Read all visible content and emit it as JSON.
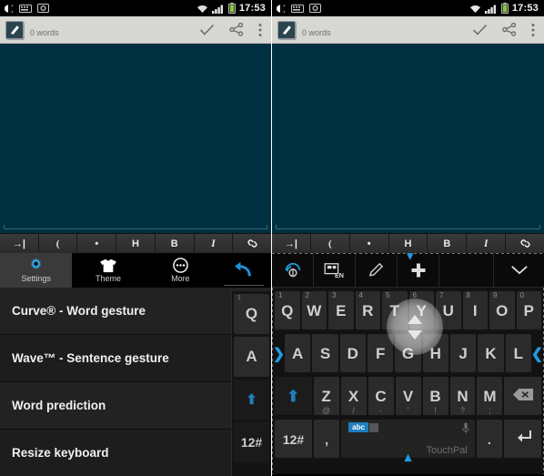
{
  "status_bar": {
    "time": "17:53",
    "left_icons": [
      "brightness-icon",
      "keyboard-icon",
      "screenshot-icon"
    ],
    "right_icons": [
      "wifi-icon",
      "signal-icon",
      "battery-icon"
    ],
    "battery_color": "#8ac63f"
  },
  "app_bar": {
    "logo": "notes-app-logo",
    "word_count": "0 words",
    "actions": [
      "done-check-icon",
      "share-icon",
      "overflow-menu-icon"
    ]
  },
  "editor": {
    "text": "",
    "background_color": "#013040"
  },
  "format_bar": {
    "keys": [
      {
        "label": "→|",
        "name": "tab-key"
      },
      {
        "label": "(",
        "name": "paren-key"
      },
      {
        "label": "•",
        "name": "bullet-key"
      },
      {
        "label": "H",
        "name": "heading-key"
      },
      {
        "label": "B",
        "name": "bold-key"
      },
      {
        "label": "I",
        "name": "italic-key"
      },
      {
        "label": "🔗",
        "name": "link-key"
      }
    ]
  },
  "left_panel": {
    "tabs": [
      {
        "label": "Settings",
        "icon": "gear-icon",
        "active": true
      },
      {
        "label": "Theme",
        "icon": "tshirt-icon",
        "active": false
      },
      {
        "label": "More",
        "icon": "more-dots-icon",
        "active": false
      }
    ],
    "back_icon": "back-arrow-icon",
    "settings_items": [
      {
        "label": "Curve® - Word gesture",
        "checked": true
      },
      {
        "label": "Wave™ - Sentence gesture",
        "checked": true
      },
      {
        "label": "Word prediction",
        "checked": true
      },
      {
        "label": "Resize keyboard",
        "checked": false
      }
    ],
    "peek_keys": [
      {
        "label": "Q",
        "hint": "1"
      },
      {
        "label": "A",
        "hint": ""
      },
      {
        "label": "⬆",
        "hint": ""
      },
      {
        "label": "12#",
        "hint": ""
      }
    ]
  },
  "right_panel": {
    "keyboard_toolbar": [
      {
        "name": "curve-gesture-icon"
      },
      {
        "name": "language-en-icon",
        "label": "EN"
      },
      {
        "name": "pencil-icon"
      },
      {
        "name": "plus-icon"
      },
      {
        "name": "chevron-down-icon"
      }
    ],
    "keyboard": {
      "row1": [
        {
          "key": "Q",
          "hint": "1"
        },
        {
          "key": "W",
          "hint": "2"
        },
        {
          "key": "E",
          "hint": "3"
        },
        {
          "key": "R",
          "hint": "4"
        },
        {
          "key": "T",
          "hint": "5"
        },
        {
          "key": "Y",
          "hint": "6"
        },
        {
          "key": "U",
          "hint": "7"
        },
        {
          "key": "I",
          "hint": "8"
        },
        {
          "key": "O",
          "hint": "9"
        },
        {
          "key": "P",
          "hint": "0"
        }
      ],
      "row2": [
        {
          "key": "A"
        },
        {
          "key": "S"
        },
        {
          "key": "D"
        },
        {
          "key": "F"
        },
        {
          "key": "G"
        },
        {
          "key": "H"
        },
        {
          "key": "J"
        },
        {
          "key": "K"
        },
        {
          "key": "L"
        }
      ],
      "row2_left_arrow": "❯",
      "row2_right_arrow": "❮",
      "row3_shift": "⬆",
      "row3": [
        {
          "key": "Z",
          "punct": "@"
        },
        {
          "key": "X",
          "punct": "/"
        },
        {
          "key": "C",
          "punct": "-"
        },
        {
          "key": "V",
          "punct": "'"
        },
        {
          "key": "B",
          "punct": "!"
        },
        {
          "key": "N",
          "punct": "?"
        },
        {
          "key": "M",
          "punct": ";"
        }
      ],
      "row3_backspace": "backspace-icon",
      "row4_numeric": "12#",
      "row4_comma": ",",
      "space_chip": "abc",
      "space_brand": "TouchPal",
      "space_mic": "microphone-icon",
      "row4_period": ".",
      "row4_enter": "enter-icon"
    },
    "resize_overlay": {
      "name": "keyboard-resize-handle",
      "up": "up-triangle",
      "down": "down-triangle"
    }
  }
}
